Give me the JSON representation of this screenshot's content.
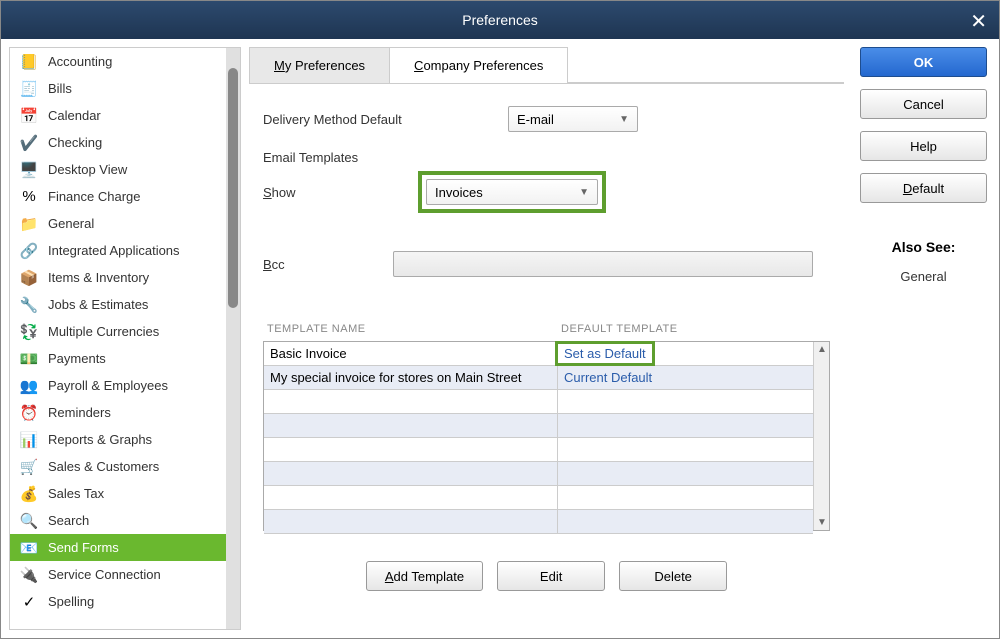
{
  "window": {
    "title": "Preferences"
  },
  "sidebar": {
    "items": [
      {
        "label": "Accounting",
        "icon": "📒",
        "selected": false
      },
      {
        "label": "Bills",
        "icon": "🧾",
        "selected": false
      },
      {
        "label": "Calendar",
        "icon": "📅",
        "selected": false
      },
      {
        "label": "Checking",
        "icon": "✔️",
        "selected": false
      },
      {
        "label": "Desktop View",
        "icon": "🖥️",
        "selected": false
      },
      {
        "label": "Finance Charge",
        "icon": "%",
        "selected": false
      },
      {
        "label": "General",
        "icon": "📁",
        "selected": false
      },
      {
        "label": "Integrated Applications",
        "icon": "🔗",
        "selected": false
      },
      {
        "label": "Items & Inventory",
        "icon": "📦",
        "selected": false
      },
      {
        "label": "Jobs & Estimates",
        "icon": "🔧",
        "selected": false
      },
      {
        "label": "Multiple Currencies",
        "icon": "💱",
        "selected": false
      },
      {
        "label": "Payments",
        "icon": "💵",
        "selected": false
      },
      {
        "label": "Payroll & Employees",
        "icon": "👥",
        "selected": false
      },
      {
        "label": "Reminders",
        "icon": "⏰",
        "selected": false
      },
      {
        "label": "Reports & Graphs",
        "icon": "📊",
        "selected": false
      },
      {
        "label": "Sales & Customers",
        "icon": "🛒",
        "selected": false
      },
      {
        "label": "Sales Tax",
        "icon": "💰",
        "selected": false
      },
      {
        "label": "Search",
        "icon": "🔍",
        "selected": false
      },
      {
        "label": "Send Forms",
        "icon": "📧",
        "selected": true
      },
      {
        "label": "Service Connection",
        "icon": "🔌",
        "selected": false
      },
      {
        "label": "Spelling",
        "icon": "✓",
        "selected": false
      }
    ]
  },
  "tabs": {
    "my_prefs": "My Preferences",
    "company_prefs": "Company Preferences",
    "active": "company_prefs"
  },
  "form": {
    "delivery_method_label": "Delivery Method Default",
    "delivery_method_value": "E-mail",
    "email_templates_label": "Email Templates",
    "show_label": "Show",
    "show_value": "Invoices",
    "bcc_label": "Bcc",
    "bcc_value": ""
  },
  "table": {
    "header_name": "TEMPLATE NAME",
    "header_default": "DEFAULT TEMPLATE",
    "rows": [
      {
        "name": "Basic Invoice",
        "default_label": "Set as Default",
        "highlighted": true
      },
      {
        "name": "My special invoice for stores on Main Street",
        "default_label": "Current Default",
        "highlighted": false
      }
    ]
  },
  "buttons": {
    "add_template": "Add Template",
    "edit": "Edit",
    "delete": "Delete",
    "ok": "OK",
    "cancel": "Cancel",
    "help": "Help",
    "default": "Default"
  },
  "also_see": {
    "title": "Also See:",
    "items": [
      "General"
    ]
  }
}
